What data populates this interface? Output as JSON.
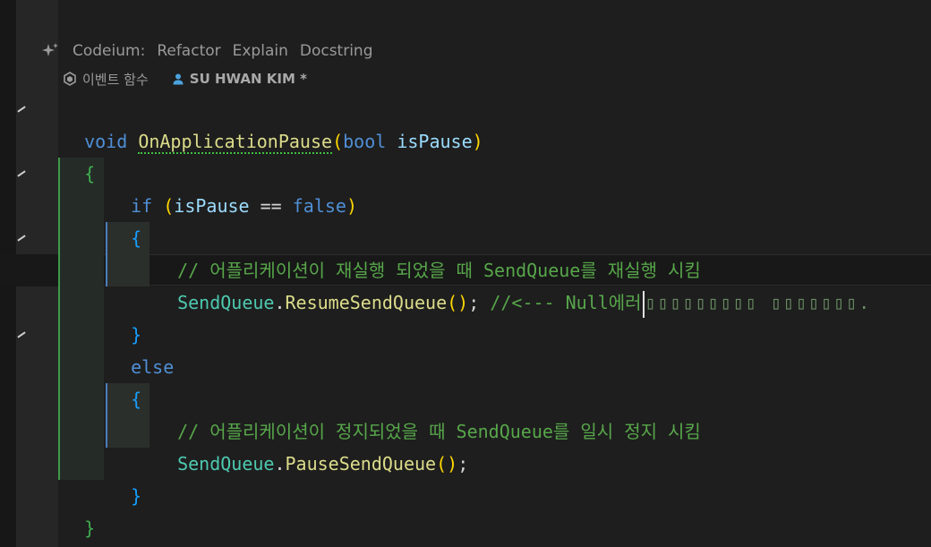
{
  "codelens": {
    "codeium": "Codeium:",
    "refactor": "Refactor",
    "explain": "Explain",
    "docstring": "Docstring",
    "event_func": "이벤트 함수",
    "author": "SU HWAN KIM *"
  },
  "code": {
    "l1_void": "void",
    "l1_name": "OnApplicationPause",
    "l1_open": "(",
    "l1_bool": "bool",
    "l1_param": "isPause",
    "l1_close": ")",
    "l2": "{",
    "l3_if": "if",
    "l3_open": "(",
    "l3_param": "isPause",
    "l3_op": "==",
    "l3_false": "false",
    "l3_close": ")",
    "l4": "{",
    "l5_comment": "// 어플리케이션이 재실행 되었을 때 SendQueue를 재실행 시킴",
    "l6_class": "SendQueue",
    "l6_dot": ".",
    "l6_method": "ResumeSendQueue",
    "l6_parens": "()",
    "l6_semi": ";",
    "l6_comment_a": "//<--- Null에러",
    "l6_comment_b": "▯▯▯▯▯▯▯▯▯ ▯▯▯▯▯▯▯.",
    "l7": "}",
    "l8_else": "else",
    "l9": "{",
    "l10_comment": "// 어플리케이션이 정지되었을 때 SendQueue를 일시 정지 시킴",
    "l11_class": "SendQueue",
    "l11_dot": ".",
    "l11_method": "PauseSendQueue",
    "l11_parens": "()",
    "l11_semi": ";",
    "l12": "}",
    "l13": "}"
  }
}
